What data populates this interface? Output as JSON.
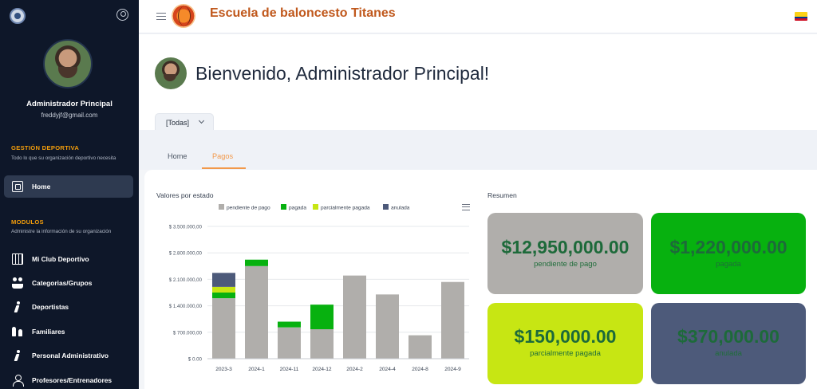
{
  "app": {
    "title": "Escuela de baloncesto Titanes"
  },
  "sidebar": {
    "user_name": "Administrador Principal",
    "user_email": "freddyjf@gmail.com",
    "sections": [
      {
        "title": "GESTIÓN DEPORTIVA",
        "description": "Todo lo que su organización deportivo necesita"
      },
      {
        "title": "MODULOS",
        "description": "Administre la información de su organización"
      }
    ],
    "items": [
      {
        "label": "Home",
        "icon": "document-icon",
        "active": true
      },
      {
        "label": "Mi Club Deportivo",
        "icon": "building-icon"
      },
      {
        "label": "Categorias/Grupos",
        "icon": "group-icon"
      },
      {
        "label": "Deportistas",
        "icon": "runner-icon"
      },
      {
        "label": "Familiares",
        "icon": "family-icon"
      },
      {
        "label": "Personal Administrativo",
        "icon": "staff-icon"
      },
      {
        "label": "Profesores/Entrenadores",
        "icon": "user-icon"
      }
    ]
  },
  "header": {
    "welcome": "Bienvenido, Administrador Principal!",
    "filter_value": "[Todas]"
  },
  "tabs": [
    {
      "label": "Home",
      "active": false
    },
    {
      "label": "Pagos",
      "active": true
    }
  ],
  "chart_section": {
    "title": "Valores por estado"
  },
  "resumen": {
    "title": "Resumen",
    "cards": [
      {
        "amount": "$12,950,000.00",
        "label": "pendiente de pago",
        "color": "#b0aeab"
      },
      {
        "amount": "$1,220,000.00",
        "label": "pagada",
        "color": "#07b10f"
      },
      {
        "amount": "$150,000.00",
        "label": "parcialmente pagada",
        "color": "#c7e613"
      },
      {
        "amount": "$370,000.00",
        "label": "anulada",
        "color": "#4d5a7a"
      }
    ]
  },
  "chart_data": {
    "type": "bar",
    "stacked": true,
    "categories": [
      "2023-3",
      "2024-1",
      "2024-11",
      "2024-12",
      "2024-2",
      "2024-4",
      "2024-8",
      "2024-9"
    ],
    "series": [
      {
        "name": "pendiente de pago",
        "color": "#b0aeab",
        "values": [
          1600000,
          2450000,
          830000,
          780000,
          2200000,
          1700000,
          620000,
          2030000
        ]
      },
      {
        "name": "pagada",
        "color": "#07b10f",
        "values": [
          150000,
          170000,
          150000,
          650000,
          0,
          0,
          0,
          0
        ]
      },
      {
        "name": "parcialmente pagada",
        "color": "#c7e613",
        "values": [
          150000,
          0,
          0,
          0,
          0,
          0,
          0,
          0
        ]
      },
      {
        "name": "anulada",
        "color": "#4d5a7a",
        "values": [
          370000,
          0,
          0,
          0,
          0,
          0,
          0,
          0
        ]
      }
    ],
    "yticks": [
      "$ 0.00",
      "$ 700.000,00",
      "$ 1.400.000,00",
      "$ 2.100.000,00",
      "$ 2.800.000,00",
      "$ 3.500.000,00"
    ],
    "ylim": [
      0,
      3500000
    ],
    "legend_position": "top"
  }
}
